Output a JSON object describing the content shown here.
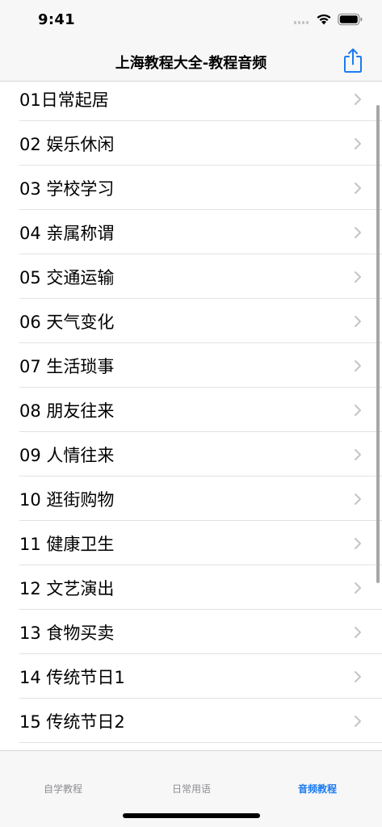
{
  "status_bar": {
    "time": "9:41"
  },
  "nav": {
    "title": "上海教程大全-教程音频"
  },
  "colors": {
    "accent": "#1a7bf2",
    "separator": "#e2e2e4",
    "bar_bg": "#f7f7f7",
    "chevron": "#c4c4c7"
  },
  "list": {
    "items": [
      {
        "label": "01日常起居"
      },
      {
        "label": "02 娱乐休闲"
      },
      {
        "label": "03 学校学习"
      },
      {
        "label": "04 亲属称谓"
      },
      {
        "label": "05 交通运输"
      },
      {
        "label": "06 天气变化"
      },
      {
        "label": "07 生活琐事"
      },
      {
        "label": "08 朋友往来"
      },
      {
        "label": "09 人情往来"
      },
      {
        "label": "10 逛街购物"
      },
      {
        "label": "11 健康卫生"
      },
      {
        "label": "12 文艺演出"
      },
      {
        "label": "13 食物买卖"
      },
      {
        "label": "14 传统节日1"
      },
      {
        "label": "15 传统节日2"
      }
    ]
  },
  "tabs": [
    {
      "label": "自学教程",
      "active": false
    },
    {
      "label": "日常用语",
      "active": false
    },
    {
      "label": "音频教程",
      "active": true
    }
  ]
}
